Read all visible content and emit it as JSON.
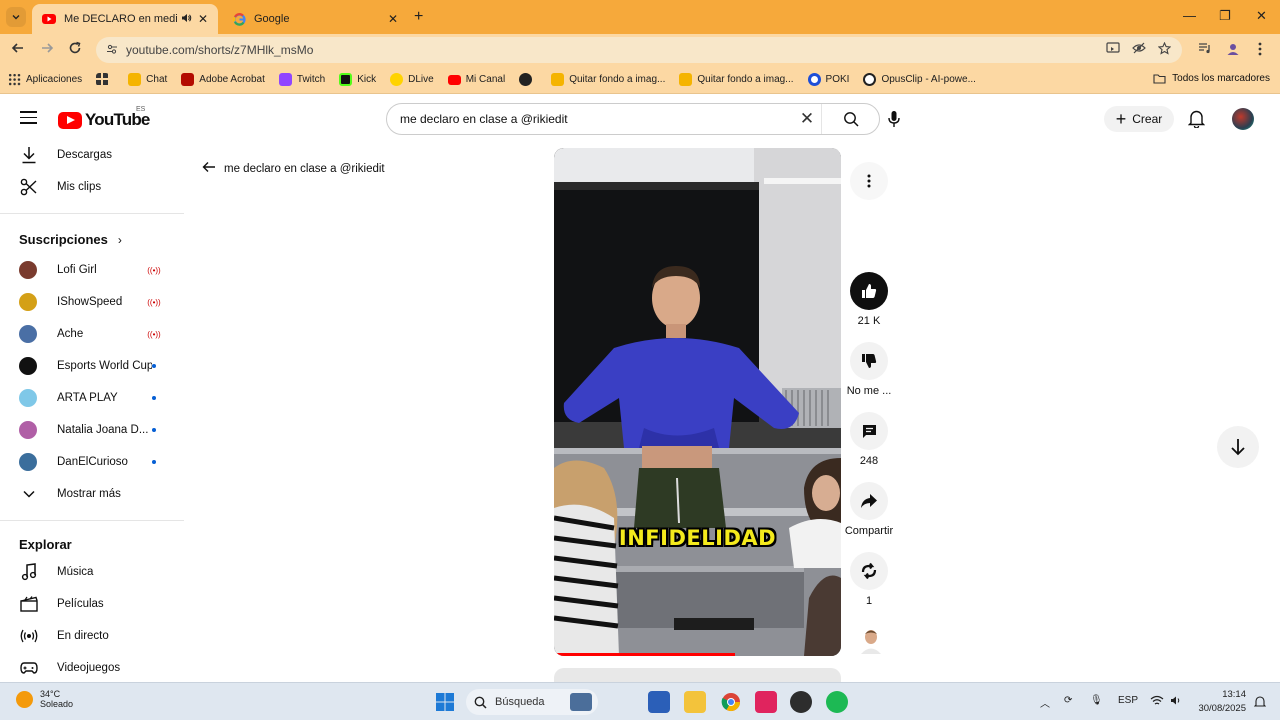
{
  "browser": {
    "tabs": [
      {
        "title": "Me DECLARO en medio de",
        "active": true
      },
      {
        "title": "Google",
        "active": false
      }
    ],
    "url": "youtube.com/shorts/z7MHlk_msMo",
    "bookmarks": [
      {
        "label": "Aplicaciones",
        "icon": "apps-grid-icon"
      },
      {
        "label": "Chat",
        "icon": "chat-icon",
        "color": "#f5b400"
      },
      {
        "label": "Adobe Acrobat",
        "icon": "acrobat-icon",
        "color": "#b30b00"
      },
      {
        "label": "Twitch",
        "icon": "twitch-icon",
        "color": "#9146ff"
      },
      {
        "label": "Kick",
        "icon": "kick-icon",
        "color": "#53fc18"
      },
      {
        "label": "DLive",
        "icon": "dlive-icon",
        "color": "#ffd300"
      },
      {
        "label": "Mi Canal",
        "icon": "youtube-icon",
        "color": "#ff0000"
      },
      {
        "label": "Quitar fondo a imag...",
        "icon": "removebg-icon",
        "color": "#f5b400"
      },
      {
        "label": "Quitar fondo a imag...",
        "icon": "removebg-icon",
        "color": "#f5b400"
      },
      {
        "label": "POKI",
        "icon": "poki-icon",
        "color": "#1d4ed8"
      },
      {
        "label": "OpusClip - AI-powe...",
        "icon": "opusclip-icon",
        "color": "#222222"
      }
    ],
    "all_bookmarks": "Todos los marcadores"
  },
  "youtube": {
    "logo_text": "YouTube",
    "region": "ES",
    "search_query": "me declaro en clase a @rikiedit",
    "create_label": "Crear"
  },
  "sidebar": {
    "top_items": [
      {
        "label": "Descargas",
        "icon": "download-icon"
      },
      {
        "label": "Mis clips",
        "icon": "scissors-icon"
      }
    ],
    "subscriptions_title": "Suscripciones",
    "subscriptions": [
      {
        "name": "Lofi Girl",
        "status": "live",
        "color": "#7a3b2e"
      },
      {
        "name": "IShowSpeed",
        "status": "live",
        "color": "#d4a017"
      },
      {
        "name": "Ache",
        "status": "live",
        "color": "#4a6fa5"
      },
      {
        "name": "Esports World Cup",
        "status": "new",
        "color": "#111111"
      },
      {
        "name": "ARTA PLAY",
        "status": "new",
        "color": "#7fc8e8"
      },
      {
        "name": "Natalia Joana D...",
        "status": "new",
        "color": "#b05fa6"
      },
      {
        "name": "DanElCurioso",
        "status": "new",
        "color": "#3b6e9c"
      }
    ],
    "show_more": "Mostrar más",
    "explore_title": "Explorar",
    "explore_items": [
      {
        "label": "Música",
        "icon": "music-note-icon"
      },
      {
        "label": "Películas",
        "icon": "clapperboard-icon"
      },
      {
        "label": "En directo",
        "icon": "live-broadcast-icon"
      },
      {
        "label": "Videojuegos",
        "icon": "gamepad-icon"
      }
    ]
  },
  "main": {
    "back_title": "me declaro en clase a @rikiedit",
    "caption": "INFIDELIDAD",
    "progress": 0.63,
    "actions": {
      "likes": "21 K",
      "dislike": "No me ...",
      "comments": "248",
      "share": "Compartir",
      "remix": "1"
    }
  },
  "taskbar": {
    "temperature": "34°C",
    "weather": "Soleado",
    "search_placeholder": "Búsqueda",
    "language": "ESP",
    "time": "13:14",
    "date": "30/08/2025"
  }
}
